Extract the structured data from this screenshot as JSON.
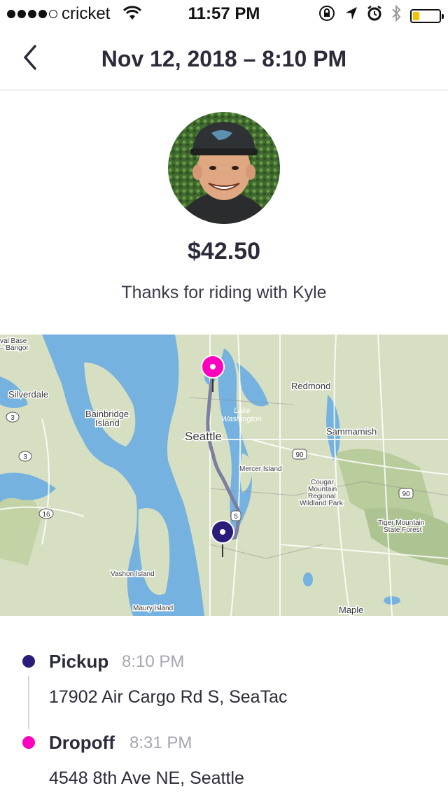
{
  "status_bar": {
    "carrier": "cricket",
    "time": "11:57 PM",
    "signal_bars_filled": 4,
    "signal_bars_total": 5,
    "battery_level": 0.25
  },
  "header": {
    "title": "Nov 12, 2018 – 8:10 PM"
  },
  "ride": {
    "fare": "$42.50",
    "thanks": "Thanks for riding with Kyle"
  },
  "map": {
    "labels": {
      "naval_base": "val Base",
      "bangor": "– Bangor",
      "silverdale": "Silverdale",
      "bainbridge": "Bainbridge",
      "island": "Island",
      "redmond": "Redmond",
      "lake": "Lake",
      "washington": "Washington",
      "seattle": "Seattle",
      "sammamish": "Sammamish",
      "mercer_island": "Mercer Island",
      "cougar_1": "Cougar",
      "cougar_2": "Mountain",
      "cougar_3": "Regional",
      "cougar_4": "Wildland Park",
      "tiger_1": "Tiger Mountain",
      "tiger_2": "State Forest",
      "vashon": "Vashon Island",
      "maury": "Maury Island",
      "maple": "Maple",
      "hwy3": "3",
      "hwy16": "16",
      "i90": "90",
      "i90b": "90",
      "i5": "5"
    },
    "colors": {
      "water": "#76b2e0",
      "land": "#d7dfc2",
      "route": "#7c7f9e",
      "pickup": "#2b1b7a",
      "dropoff": "#ff00bf"
    }
  },
  "timeline": {
    "pickup": {
      "label": "Pickup",
      "time": "8:10 PM",
      "address": "17902 Air Cargo Rd S, SeaTac",
      "color": "#2b1b7a"
    },
    "dropoff": {
      "label": "Dropoff",
      "time": "8:31 PM",
      "address": "4548 8th Ave NE, Seattle",
      "color": "#ff00bf"
    }
  }
}
